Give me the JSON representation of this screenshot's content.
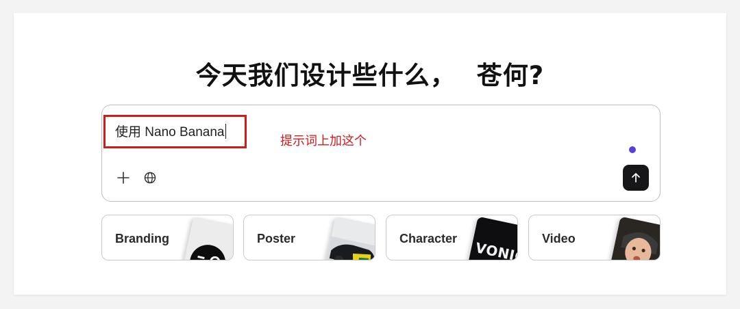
{
  "headline": {
    "text": "今天我们设计些什么，",
    "name": "苍何?"
  },
  "prompt": {
    "value": "使用 Nano Banana"
  },
  "annotation": {
    "text": "提示词上加这个",
    "color": "#d11a1a"
  },
  "toolbar": {
    "add_icon": "plus-icon",
    "web_icon": "globe-icon",
    "send_icon": "arrow-up-icon"
  },
  "status_dot_color": "#5b3fd9",
  "cards": [
    {
      "label": "Branding",
      "thumbnail": "branding-thumbnail"
    },
    {
      "label": "Poster",
      "thumbnail": "poster-thumbnail"
    },
    {
      "label": "Character",
      "thumbnail": "character-thumbnail",
      "thumb_text": "VONIC"
    },
    {
      "label": "Video",
      "thumbnail": "video-thumbnail"
    }
  ]
}
